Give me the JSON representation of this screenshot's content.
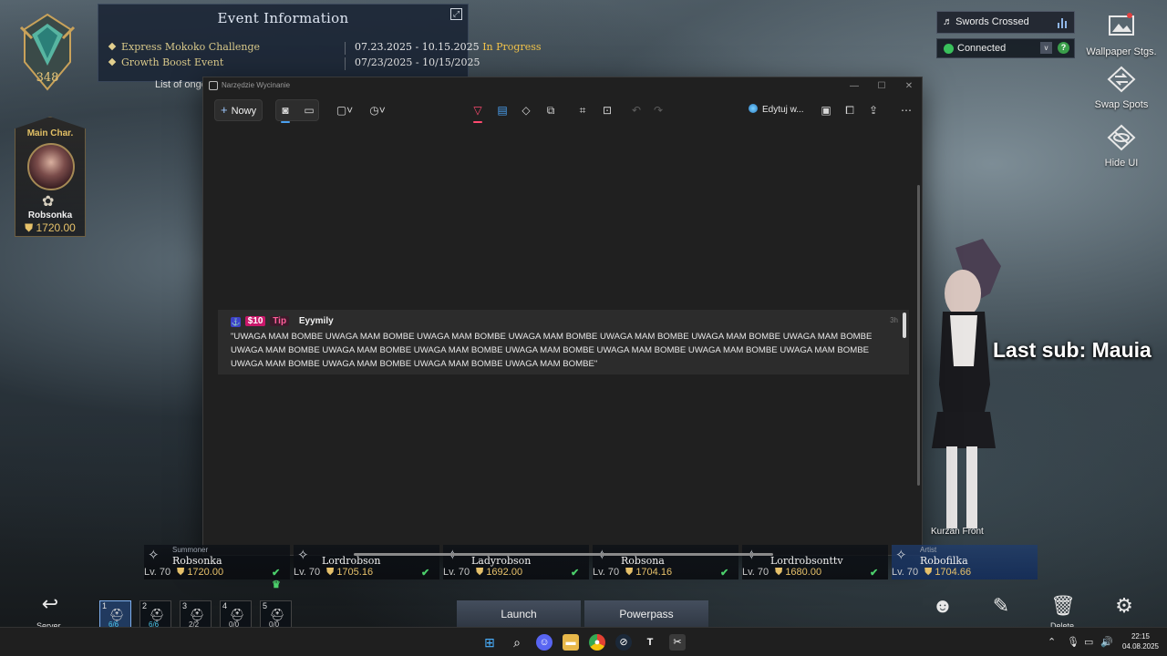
{
  "event": {
    "title": "Event Information",
    "rows": [
      {
        "name": "Express Mokoko Challenge",
        "date": "07.23.2025 - 10.15.2025",
        "status": "In Progress"
      },
      {
        "name": "Growth Boost Event",
        "date": "07/23/2025 - 10/15/2025",
        "status": ""
      }
    ],
    "list_label": "List of ongoi"
  },
  "rank": {
    "level": "348"
  },
  "main_char": {
    "label": "Main Char.",
    "name": "Robsonka",
    "gear": "1720.00"
  },
  "music": {
    "title": "Swords Crossed"
  },
  "connection": {
    "status": "Connected",
    "help": "?"
  },
  "side_tools": {
    "wallpaper": "Wallpaper Stgs.",
    "swap": "Swap Spots",
    "hide": "Hide UI"
  },
  "stream_overlay": {
    "last_sub": "Last sub: Mauia"
  },
  "snip": {
    "title": "Narzędzie Wycinanie",
    "new_label": "Nowy",
    "edit_label": "Edytuj w...",
    "tip": {
      "amount": "$10",
      "label": "Tip",
      "user": "Eyymily",
      "time": "3h",
      "message": "\"UWAGA MAM BOMBE UWAGA MAM BOMBE UWAGA MAM BOMBE UWAGA MAM BOMBE UWAGA MAM BOMBE UWAGA MAM BOMBE UWAGA MAM BOMBE UWAGA MAM BOMBE UWAGA MAM BOMBE UWAGA MAM BOMBE UWAGA MAM BOMBE UWAGA MAM BOMBE UWAGA MAM BOMBE UWAGA MAM BOMBE UWAGA MAM BOMBE UWAGA MAM BOMBE UWAGA MAM BOMBE UWAGA MAM BOMBE\""
    }
  },
  "characters": [
    {
      "class": "Summoner",
      "name": "Robsonka",
      "level": "Lv. 70",
      "gear": "1720.00",
      "badge": "✔ ♛"
    },
    {
      "class": "",
      "name": "Lordrobson",
      "level": "Lv. 70",
      "gear": "1705.16",
      "badge": "✔"
    },
    {
      "class": "",
      "name": "Ladyrobson",
      "level": "Lv. 70",
      "gear": "1692.00",
      "badge": "✔"
    },
    {
      "class": "",
      "name": "Robsona",
      "level": "Lv. 70",
      "gear": "1704.16",
      "badge": "✔"
    },
    {
      "class": "",
      "name": "Lordrobsonttv",
      "level": "Lv. 70",
      "gear": "1680.00",
      "badge": "✔"
    },
    {
      "class": "Artist",
      "name": "Robofilka",
      "level": "Lv. 70",
      "gear": "1704.66",
      "badge": ""
    }
  ],
  "kurzan": "Kurzan Front",
  "slots": [
    {
      "n": "1",
      "count": "6/6"
    },
    {
      "n": "2",
      "count": "6/6"
    },
    {
      "n": "3",
      "count": "2/2"
    },
    {
      "n": "4",
      "count": "0/0"
    },
    {
      "n": "5",
      "count": "0/0"
    }
  ],
  "bottom": {
    "server": "Server",
    "launch": "Launch",
    "powerpass": "Powerpass",
    "delete": "Delete"
  },
  "clock": {
    "time": "22:15",
    "date": "04.08.2025"
  }
}
